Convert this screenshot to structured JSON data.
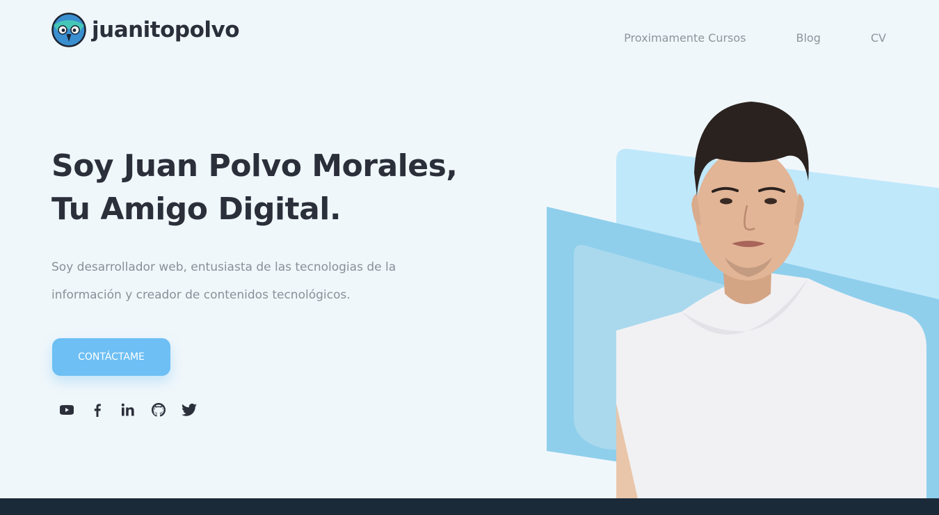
{
  "brand": {
    "name": "juanitopolvo",
    "logo_icon": "owl-logo-icon"
  },
  "nav": {
    "items": [
      {
        "label": "Proximamente Cursos"
      },
      {
        "label": "Blog"
      },
      {
        "label": "CV"
      }
    ]
  },
  "hero": {
    "title_line1": "Soy Juan Polvo Morales,",
    "title_line2": "Tu Amigo Digital.",
    "description": "Soy desarrollador web, entusiasta de las tecnologias de la información y creador de contenidos tecnológicos.",
    "cta_label": "CONTÁCTAME",
    "image": "portrait-photo"
  },
  "socials": [
    {
      "icon": "youtube-icon"
    },
    {
      "icon": "facebook-icon"
    },
    {
      "icon": "linkedin-icon"
    },
    {
      "icon": "github-icon"
    },
    {
      "icon": "twitter-icon"
    }
  ],
  "colors": {
    "background": "#f0f7fb",
    "accent": "#6dbff4",
    "text_dark": "#2b2f3a",
    "text_muted": "#8a8f97",
    "footer": "#1b2a38"
  }
}
